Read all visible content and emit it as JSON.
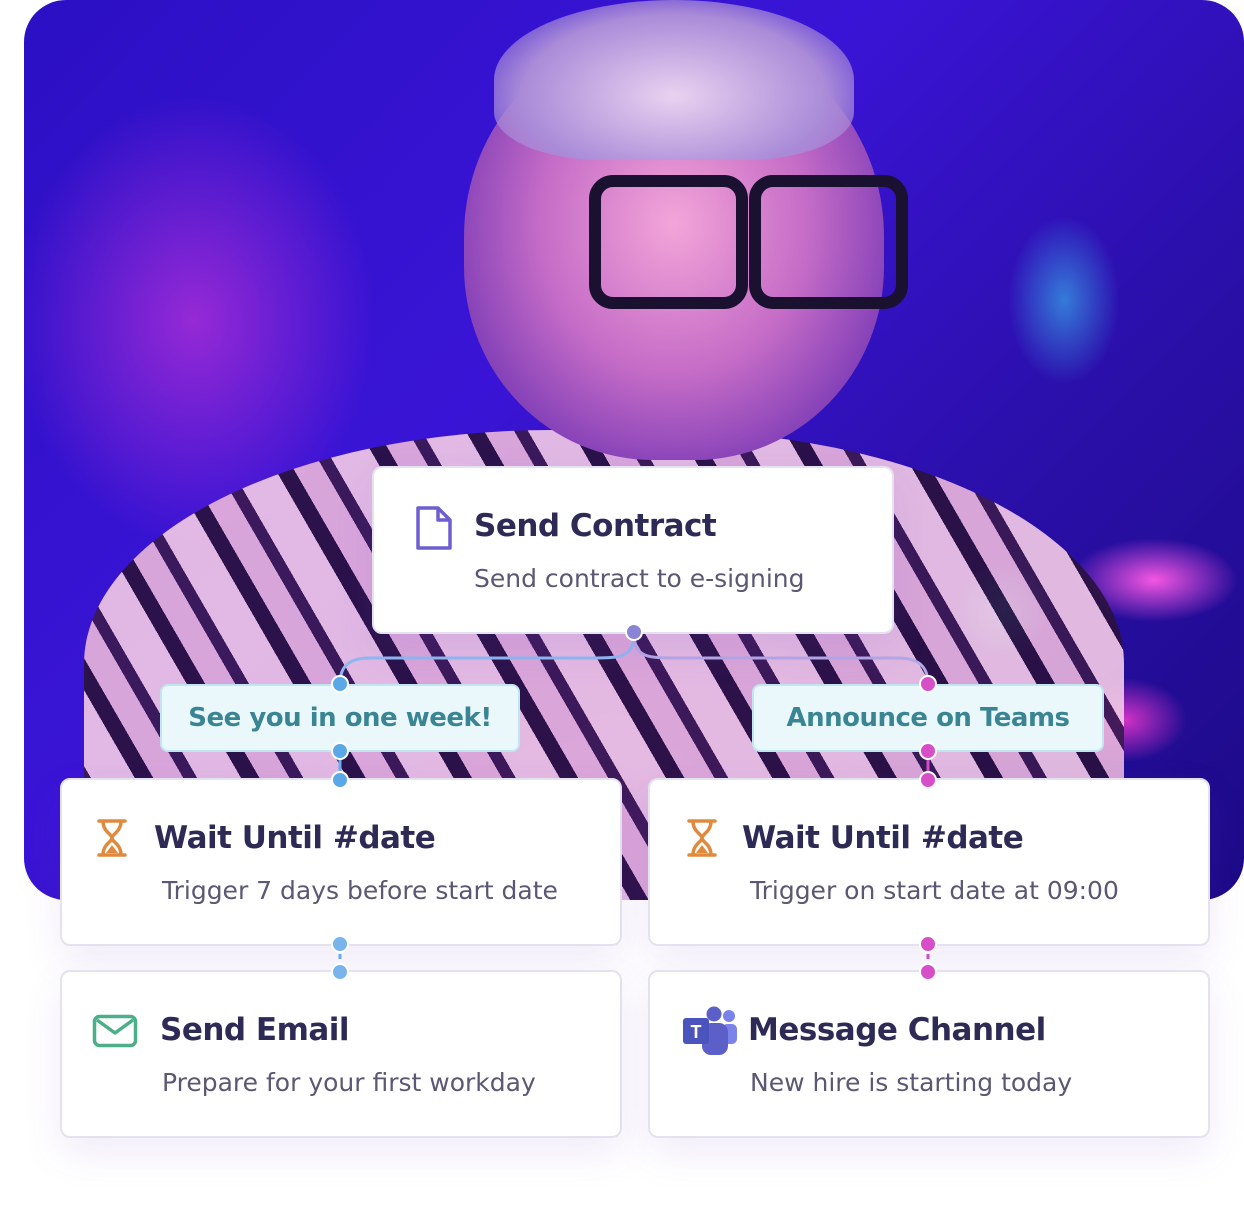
{
  "nodes": {
    "send_contract": {
      "title": "Send Contract",
      "subtitle": "Send contract to e-signing",
      "icon": "document-icon"
    },
    "wait_left": {
      "title": "Wait Until #date",
      "subtitle": "Trigger 7 days before start date",
      "icon": "hourglass-icon"
    },
    "wait_right": {
      "title": "Wait Until #date",
      "subtitle": "Trigger on start date at 09:00",
      "icon": "hourglass-icon"
    },
    "send_email": {
      "title": "Send Email",
      "subtitle": "Prepare for your first workday",
      "icon": "mail-icon"
    },
    "message_channel": {
      "title": "Message Channel",
      "subtitle": "New hire is starting today",
      "icon": "teams-icon"
    }
  },
  "labels": {
    "left_branch": "See you in one week!",
    "right_branch": "Announce on Teams"
  },
  "colors": {
    "title": "#2d2a55",
    "subtitle": "#5a5872",
    "left_branch": "#5aa8e6",
    "right_branch": "#d64fc9",
    "pill_text": "#3a8593",
    "hourglass": "#e08a3e",
    "mail": "#4caf8a",
    "document": "#6e5fd1",
    "teams": "#5b5fc7"
  }
}
